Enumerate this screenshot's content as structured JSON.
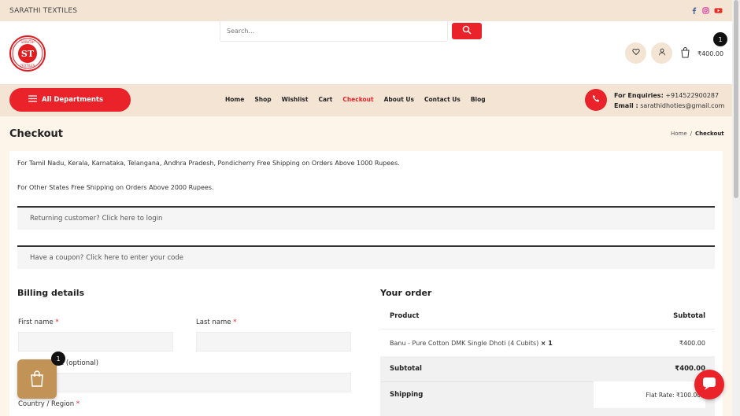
{
  "colors": {
    "accent": "#e92329",
    "beige": "#f4e4d4",
    "bag": "#c19357"
  },
  "topbar": {
    "brand": "SARATHI TEXTILES",
    "social_icons": [
      "facebook-icon",
      "instagram-icon",
      "youtube-icon"
    ]
  },
  "header": {
    "logo_text": "SARATHI TEXTILES",
    "search": {
      "placeholder": "Search..."
    },
    "cart": {
      "amount": "₹400.00",
      "count": "1"
    },
    "icons": [
      "heart-icon",
      "user-icon",
      "cart-icon",
      "search-icon"
    ]
  },
  "nav": {
    "all_departments": "All Departments",
    "items": [
      {
        "label": "Home",
        "active": false
      },
      {
        "label": "Shop",
        "active": false
      },
      {
        "label": "Wishlist",
        "active": false
      },
      {
        "label": "Cart",
        "active": false
      },
      {
        "label": "Checkout",
        "active": true
      },
      {
        "label": "About Us",
        "active": false
      },
      {
        "label": "Contact Us",
        "active": false
      },
      {
        "label": "Blog",
        "active": false
      }
    ],
    "enquiry_label": "For Enquiries:",
    "enquiry_phone": "+914522900287",
    "email_label": "Email :",
    "email": "sarathidhoties@gmail.com"
  },
  "page": {
    "title": "Checkout",
    "breadcrumb": {
      "home": "Home",
      "sep": "/",
      "current": "Checkout"
    }
  },
  "notices": {
    "line1": "For Tamil Nadu, Kerala, Karnataka, Telangana, Andhra Pradesh, Pondicherry Free Shipping on Orders Above 1000 Rupees.",
    "line2": "For Other States Free Shipping on Orders Above 2000 Rupees.",
    "returning": "Returning customer?",
    "returning_link": "Click here to login",
    "coupon": "Have a coupon?",
    "coupon_link": "Click here to enter your code"
  },
  "billing": {
    "heading": "Billing details",
    "first_name": "First name",
    "last_name": "Last name",
    "company_partial": "e (optional)",
    "country": "Country / Region",
    "required": "*"
  },
  "order": {
    "heading": "Your order",
    "col_product": "Product",
    "col_subtotal": "Subtotal",
    "item_name": "Banu - Pure Cotton DMK Single Dhoti (4 Cubits)",
    "item_qty": "× 1",
    "item_price": "₹400.00",
    "subtotal_label": "Subtotal",
    "subtotal_value": "₹400.00",
    "shipping_label": "Shipping",
    "shipping_value": "Flat Rate: ₹100.00"
  },
  "floating": {
    "bag_count": "1"
  }
}
